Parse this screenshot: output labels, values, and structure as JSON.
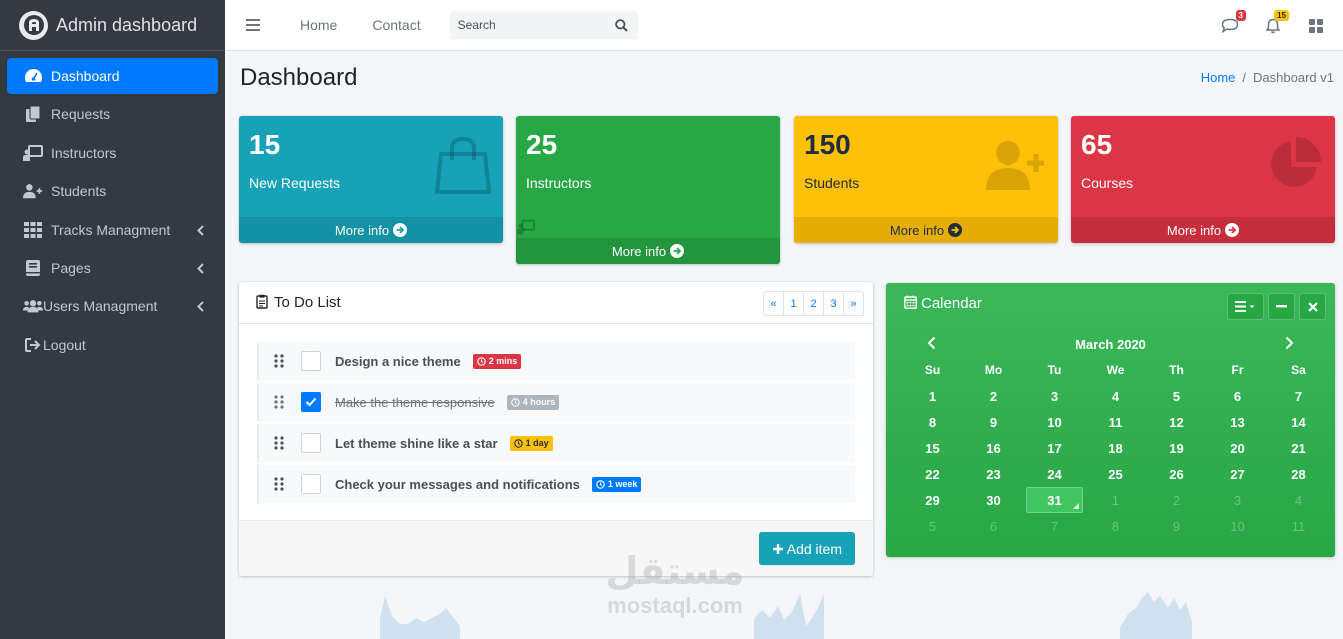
{
  "brand": {
    "name": "Admin dashboard",
    "icon": "logo-icon"
  },
  "sidebar": {
    "items": [
      {
        "label": "Dashboard",
        "icon": "tachometer-icon",
        "active": true
      },
      {
        "label": "Requests",
        "icon": "copy-icon"
      },
      {
        "label": "Instructors",
        "icon": "chalkboard-teacher-icon"
      },
      {
        "label": "Students",
        "icon": "user-plus-icon"
      },
      {
        "label": "Tracks Managment",
        "icon": "th-icon",
        "submenu": true
      },
      {
        "label": "Pages",
        "icon": "book-icon",
        "submenu": true
      },
      {
        "label": "Users Managment",
        "icon": "users-icon",
        "submenu": true
      },
      {
        "label": "Logout",
        "icon": "sign-out-icon"
      }
    ]
  },
  "topbar": {
    "home_label": "Home",
    "contact_label": "Contact",
    "search_placeholder": "Search",
    "messages_count": "3",
    "notifications_count": "15"
  },
  "page": {
    "title": "Dashboard",
    "breadcrumb_home": "Home",
    "breadcrumb_current": "Dashboard v1"
  },
  "stats": [
    {
      "value": "15",
      "label": "New Requests",
      "more": "More info",
      "color": "#17a2b8",
      "icon": "shopping-bag-icon"
    },
    {
      "value": "25",
      "label": "Instructors",
      "more": "More info",
      "color": "#28a745",
      "icon": "chalkboard-teacher-icon"
    },
    {
      "value": "150",
      "label": "Students",
      "more": "More info",
      "color": "#ffc107",
      "icon": "user-plus-icon"
    },
    {
      "value": "65",
      "label": "Courses",
      "more": "More info",
      "color": "#dc3545",
      "icon": "pie-chart-icon"
    }
  ],
  "todo": {
    "title": "To Do List",
    "pages": [
      "«",
      "1",
      "2",
      "3",
      "»"
    ],
    "items": [
      {
        "text": "Design a nice theme",
        "tag": "2 mins",
        "tag_color": "#dc3545",
        "checked": false
      },
      {
        "text": "Make the theme responsive",
        "tag": "4 hours",
        "tag_color": "#adb5bd",
        "checked": true
      },
      {
        "text": "Let theme shine like a star",
        "tag": "1 day",
        "tag_color": "#ffc107",
        "checked": false
      },
      {
        "text": "Check your messages and notifications",
        "tag": "1 week",
        "tag_color": "#007bff",
        "checked": false
      }
    ],
    "add_label": "Add item"
  },
  "calendar": {
    "title": "Calendar",
    "month": "March 2020",
    "weekdays": [
      "Su",
      "Mo",
      "Tu",
      "We",
      "Th",
      "Fr",
      "Sa"
    ],
    "weeks": [
      [
        "1",
        "2",
        "3",
        "4",
        "5",
        "6",
        "7"
      ],
      [
        "8",
        "9",
        "10",
        "11",
        "12",
        "13",
        "14"
      ],
      [
        "15",
        "16",
        "17",
        "18",
        "19",
        "20",
        "21"
      ],
      [
        "22",
        "23",
        "24",
        "25",
        "26",
        "27",
        "28"
      ],
      [
        "29",
        "30",
        "31",
        "1",
        "2",
        "3",
        "4"
      ],
      [
        "5",
        "6",
        "7",
        "8",
        "9",
        "10",
        "11"
      ]
    ],
    "today": "31"
  },
  "watermark": {
    "arabic": "مستقل",
    "latin": "mostaql.com"
  }
}
